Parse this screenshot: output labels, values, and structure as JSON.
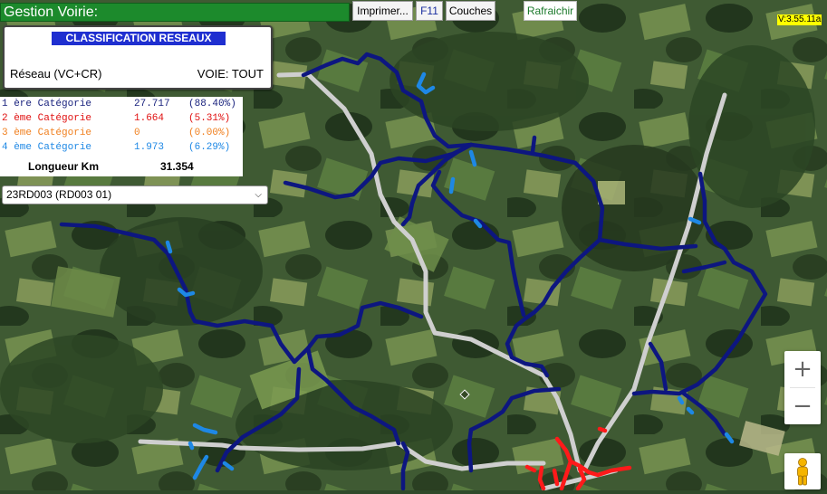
{
  "app": {
    "title": "Gestion Voirie:",
    "version": "V:3.55.11a"
  },
  "toolbar": {
    "print_label": "Imprimer...",
    "f11_label": "F11",
    "layers_label": "Couches",
    "refresh_label": "Rafraichir"
  },
  "classification": {
    "title": "CLASSIFICATION RESEAUX",
    "network": "Réseau (VC+CR)",
    "voie": "VOIE: TOUT"
  },
  "stats": {
    "rows": [
      {
        "name": "1 ère Catégorie",
        "value": "27.717",
        "pct": "(88.40%)",
        "color": "#1a237e"
      },
      {
        "name": "2 ème Catégorie",
        "value": "1.664",
        "pct": "(5.31%)",
        "color": "#e01010"
      },
      {
        "name": "3 ème Catégorie",
        "value": "0",
        "pct": "(0.00%)",
        "color": "#f08020"
      },
      {
        "name": "4 ème Catégorie",
        "value": "1.973",
        "pct": "(6.29%)",
        "color": "#1e88e5"
      }
    ],
    "total_label": "Longueur Km",
    "total_value": "31.354"
  },
  "road_select": {
    "value": "23RD003 (RD003 01)"
  },
  "controls": {
    "zoom_in": "+",
    "zoom_out": "−",
    "zoom_in_icon": "plus-icon",
    "zoom_out_icon": "minus-icon",
    "streetview_icon": "pegman-icon"
  },
  "colors": {
    "cat1": "#0d1680",
    "cat2": "#ff1a1a",
    "cat4": "#1e88e5",
    "main_road": "#cfcfcf",
    "toolbar_green": "#1c8a2c"
  }
}
